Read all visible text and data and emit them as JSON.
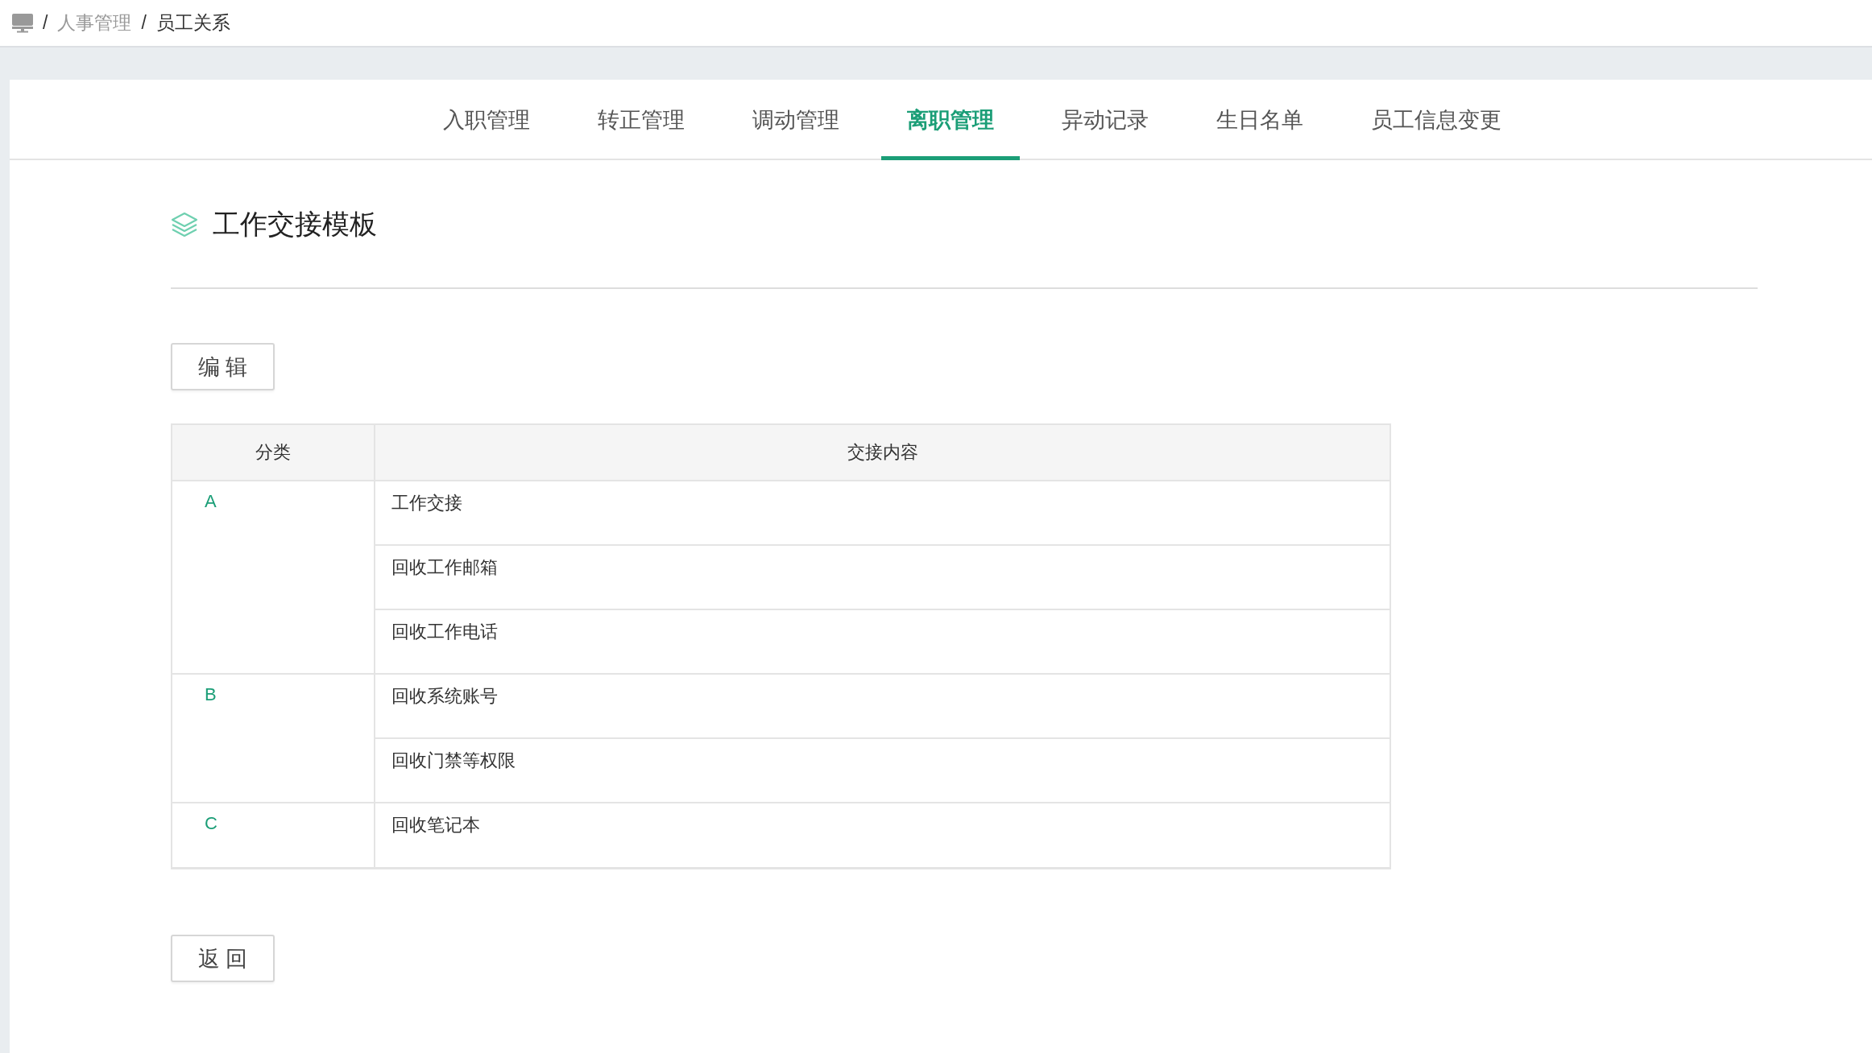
{
  "breadcrumb": {
    "items": [
      {
        "label": "人事管理",
        "current": false
      },
      {
        "label": "员工关系",
        "current": true
      }
    ],
    "separator": "/"
  },
  "tabs": [
    {
      "label": "入职管理",
      "selected": false
    },
    {
      "label": "转正管理",
      "selected": false
    },
    {
      "label": "调动管理",
      "selected": false
    },
    {
      "label": "离职管理",
      "selected": true
    },
    {
      "label": "异动记录",
      "selected": false
    },
    {
      "label": "生日名单",
      "selected": false
    },
    {
      "label": "员工信息变更",
      "selected": false
    }
  ],
  "section": {
    "title": "工作交接模板"
  },
  "edit_button": "编 辑",
  "table": {
    "columns": [
      "分类",
      "交接内容"
    ],
    "groups": [
      {
        "category": "A",
        "items": [
          "工作交接",
          "回收工作邮箱",
          "回收工作电话"
        ]
      },
      {
        "category": "B",
        "items": [
          "回收系统账号",
          "回收门禁等权限"
        ]
      },
      {
        "category": "C",
        "items": [
          "回收笔记本"
        ]
      }
    ]
  },
  "back_button": "返 回"
}
